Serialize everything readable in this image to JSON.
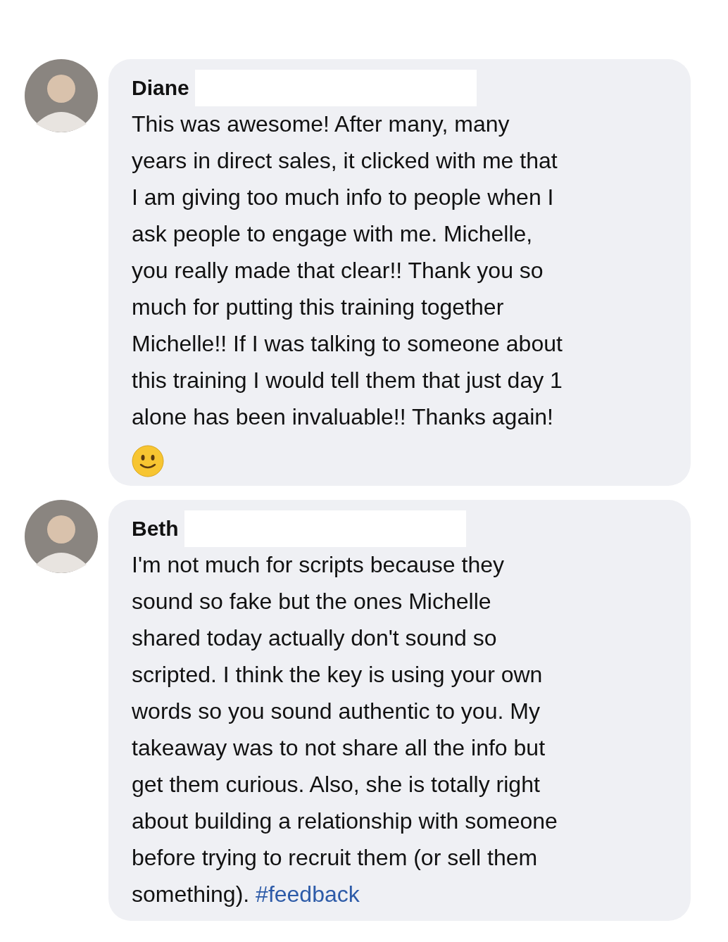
{
  "comments": [
    {
      "name": "Diane",
      "name_hidden": true,
      "lines": [
        "This was awesome! After many, many",
        "years in direct sales, it clicked with me that",
        "I am giving too much info to people when I",
        "ask people to engage with me. Michelle,",
        "you really made that clear!! Thank you so",
        "much for putting this training together",
        "Michelle!! If I was talking to someone about",
        "this training I would tell them that just day 1",
        "alone has been invaluable!! Thanks again!"
      ],
      "emoji": true
    },
    {
      "name": "Beth",
      "name_hidden": true,
      "lines": [
        "I'm not much for scripts because they",
        "sound so fake but the ones Michelle",
        "shared today actually don't sound so",
        "scripted. I think the key is using your own",
        "words so you sound authentic to you. My",
        "takeaway was to not share all the info but",
        "get them curious. Also, she is totally right",
        "about building a relationship with someone",
        "before trying to recruit them (or sell them",
        "something)."
      ],
      "hashtag": "#feedback",
      "emoji": false
    }
  ]
}
